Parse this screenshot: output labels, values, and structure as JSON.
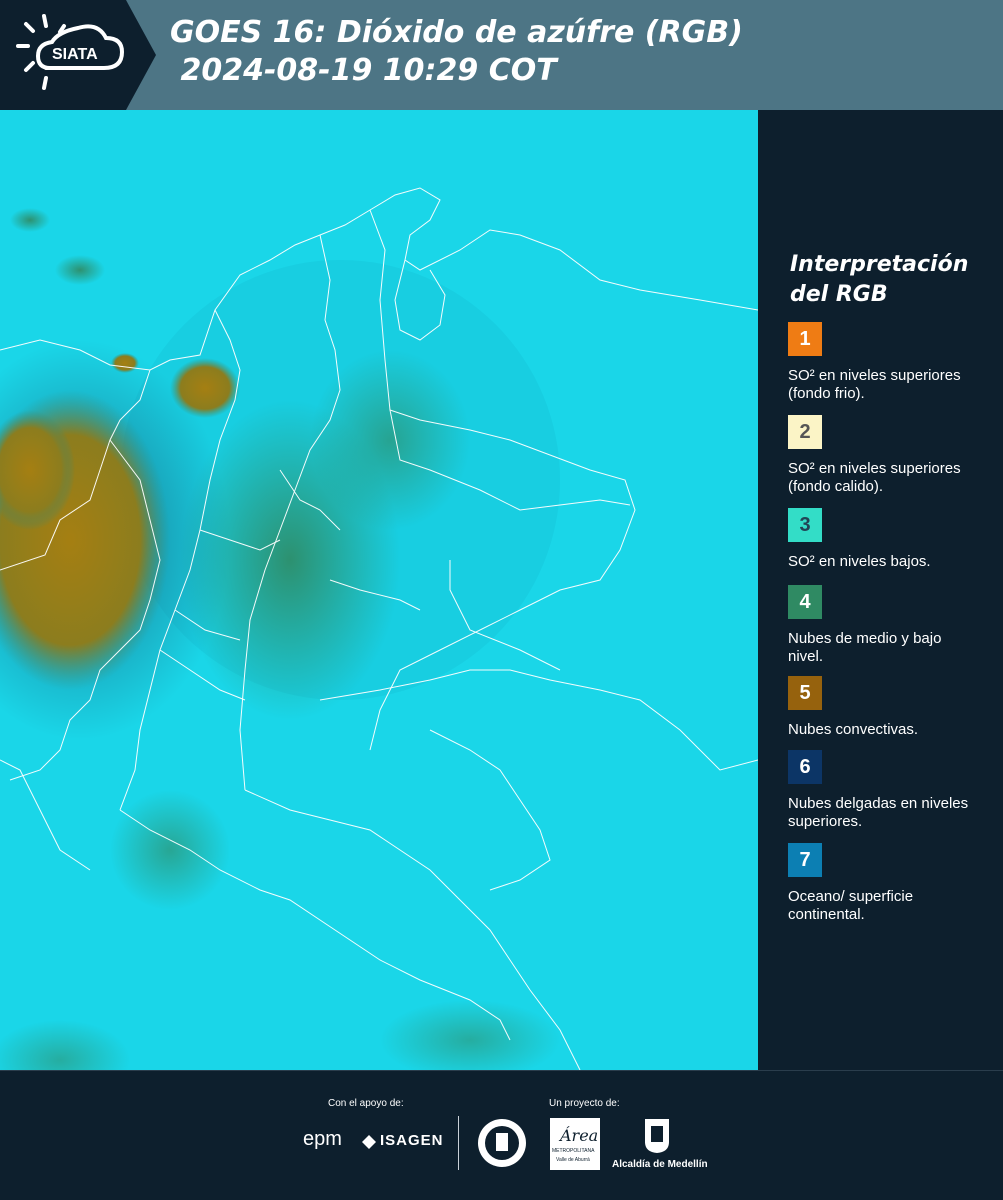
{
  "header": {
    "logo_text": "SIATA",
    "title_line1": "GOES 16: Dióxido de azúfre (RGB)",
    "title_line2": " 2024-08-19 10:29 COT",
    "background_color": "#4d7585"
  },
  "map": {
    "icon": "satellite-map",
    "ocean_color": "#1ad6e8",
    "convective_cloud_color": "#a57f12",
    "outline_color": "#ffffff"
  },
  "legend": {
    "title": "Interpretación del RGB",
    "items": [
      {
        "number": "1",
        "color": "#ef7c14",
        "text": "SO² en niveles superiores (fondo frio)."
      },
      {
        "number": "2",
        "color": "#fbf4c6",
        "text": "SO² en niveles superiores (fondo calido)."
      },
      {
        "number": "3",
        "color": "#33ddc7",
        "text": "SO² en niveles bajos."
      },
      {
        "number": "4",
        "color": "#2f8a63",
        "text": "Nubes de medio y bajo nivel."
      },
      {
        "number": "5",
        "color": "#96620d",
        "text": "Nubes convectivas."
      },
      {
        "number": "6",
        "color": "#0c3566",
        "text": "Nubes delgadas en niveles superiores."
      },
      {
        "number": "7",
        "color": "#0c7fb3",
        "text": "Oceano/ superficie continental."
      }
    ]
  },
  "footer": {
    "support_label": "Con el apoyo de:",
    "project_label": "Un proyecto de:",
    "sponsor_epm": "epm",
    "sponsor_isagen": "ISAGEN",
    "sponsor_area": "Área",
    "sponsor_area_sub": "METROPOLITANA",
    "sponsor_area_sub2": "Valle de Aburrá",
    "sponsor_alcaldia": "Alcaldía de Medellín"
  }
}
